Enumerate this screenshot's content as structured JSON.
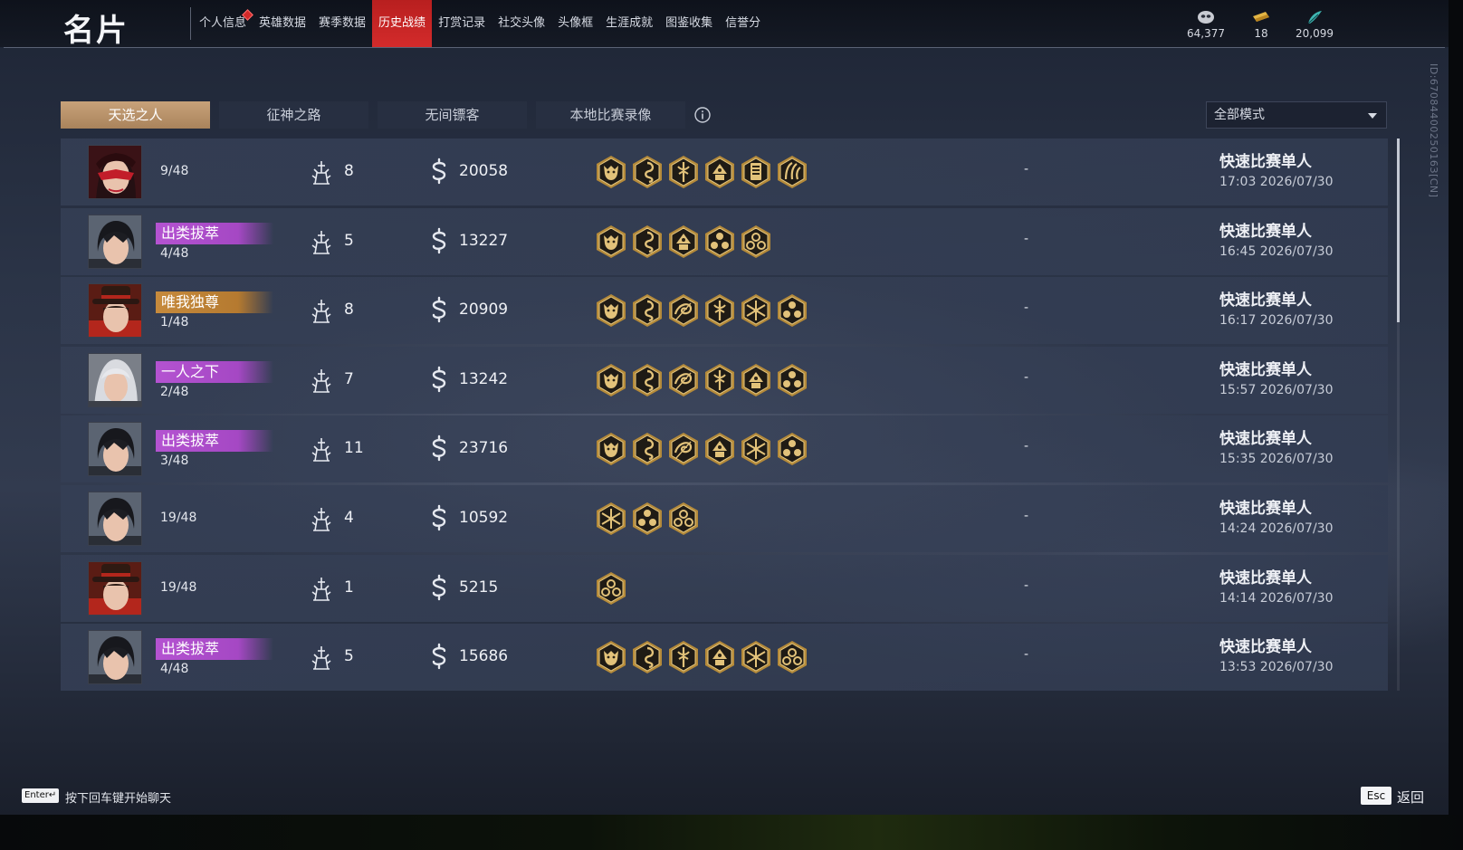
{
  "header": {
    "title": "名片",
    "nav": [
      {
        "label": "个人信息",
        "badge": true
      },
      {
        "label": "英雄数据"
      },
      {
        "label": "赛季数据"
      },
      {
        "label": "历史战绩",
        "active": true
      },
      {
        "label": "打赏记录"
      },
      {
        "label": "社交头像"
      },
      {
        "label": "头像框"
      },
      {
        "label": "生涯成就"
      },
      {
        "label": "图鉴收集"
      },
      {
        "label": "信誉分"
      }
    ],
    "currencies": [
      {
        "icon": "mask-coin-icon",
        "value": "64,377"
      },
      {
        "icon": "gold-ticket-icon",
        "value": "18"
      },
      {
        "icon": "jade-feather-icon",
        "value": "20,099"
      }
    ],
    "id_text": "ID:6708440025016З[CN]"
  },
  "subtabs": [
    "天选之人",
    "征神之路",
    "无间镖客",
    "本地比赛录像"
  ],
  "active_subtab": 0,
  "mode_filter": "全部模式",
  "matches": [
    {
      "avatar": "red-mask",
      "rank_title": "",
      "rank_color": "",
      "place": "9/48",
      "level": "8",
      "coins": "20058",
      "traits": [
        "demon-trait-icon",
        "spiral-trait-icon",
        "staff-trait-icon",
        "temple-trait-icon",
        "scroll-trait-icon",
        "claw-trait-icon"
      ],
      "extra": "-",
      "mode": "快速比赛单人",
      "time": "17:03  2026/07/30"
    },
    {
      "avatar": "dark-hair",
      "rank_title": "出类拔萃",
      "rank_color": "purple",
      "place": "4/48",
      "level": "5",
      "coins": "13227",
      "traits": [
        "demon-trait-icon",
        "spiral-trait-icon",
        "temple-trait-icon",
        "trinity-trait-icon",
        "cloud-trait-icon"
      ],
      "extra": "-",
      "mode": "快速比赛单人",
      "time": "16:45  2026/07/30"
    },
    {
      "avatar": "red-hat",
      "rank_title": "唯我独尊",
      "rank_color": "gold",
      "place": "1/48",
      "level": "8",
      "coins": "20909",
      "traits": [
        "demon-trait-icon",
        "spiral-trait-icon",
        "swirl-trait-icon",
        "staff-trait-icon",
        "star-burst-trait-icon",
        "trinity-trait-icon"
      ],
      "extra": "-",
      "mode": "快速比赛单人",
      "time": "16:17  2026/07/30"
    },
    {
      "avatar": "silver-hair",
      "rank_title": "一人之下",
      "rank_color": "purple",
      "place": "2/48",
      "level": "7",
      "coins": "13242",
      "traits": [
        "demon-trait-icon",
        "spiral-trait-icon",
        "swirl-trait-icon",
        "staff-trait-icon",
        "temple-trait-icon",
        "trinity-trait-icon"
      ],
      "extra": "-",
      "mode": "快速比赛单人",
      "time": "15:57  2026/07/30"
    },
    {
      "avatar": "dark-hair",
      "rank_title": "出类拔萃",
      "rank_color": "purple",
      "place": "3/48",
      "level": "11",
      "coins": "23716",
      "traits": [
        "demon-trait-icon",
        "spiral-trait-icon",
        "swirl-trait-icon",
        "temple-trait-icon",
        "star-burst-trait-icon",
        "trinity-trait-icon"
      ],
      "extra": "-",
      "mode": "快速比赛单人",
      "time": "15:35  2026/07/30"
    },
    {
      "avatar": "dark-hair",
      "rank_title": "",
      "rank_color": "",
      "place": "19/48",
      "level": "4",
      "coins": "10592",
      "traits": [
        "star-burst-trait-icon",
        "trinity-trait-icon",
        "cloud-trait-icon"
      ],
      "extra": "-",
      "mode": "快速比赛单人",
      "time": "14:24  2026/07/30"
    },
    {
      "avatar": "red-hat",
      "rank_title": "",
      "rank_color": "",
      "place": "19/48",
      "level": "1",
      "coins": "5215",
      "traits": [
        "cloud-trait-icon"
      ],
      "extra": "-",
      "mode": "快速比赛单人",
      "time": "14:14  2026/07/30"
    },
    {
      "avatar": "dark-hair",
      "rank_title": "出类拔萃",
      "rank_color": "purple",
      "place": "4/48",
      "level": "5",
      "coins": "15686",
      "traits": [
        "demon-trait-icon",
        "spiral-trait-icon",
        "staff-trait-icon",
        "temple-trait-icon",
        "star-burst-trait-icon",
        "cloud-trait-icon"
      ],
      "extra": "-",
      "mode": "快速比赛单人",
      "time": "13:53  2026/07/30"
    }
  ],
  "footer": {
    "enter_key": "Enter↵",
    "chat_hint": "按下回车键开始聊天",
    "esc_key": "Esc",
    "back_label": "返回"
  },
  "colors": {
    "nav_active": "#c82525",
    "tab_active": "#b88e63",
    "rank_purple": "#b453d1",
    "rank_gold": "#c68a3c",
    "trait_gold": "#d9b86a"
  }
}
